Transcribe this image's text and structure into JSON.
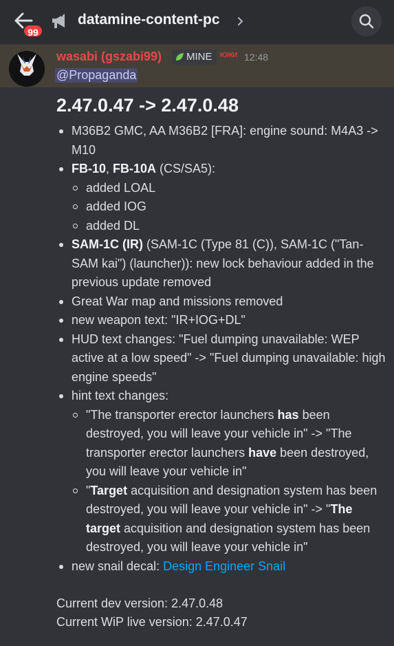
{
  "header": {
    "badge_count": "99",
    "channel_name": "datamine-content-pc"
  },
  "message": {
    "author": "wasabi (gszabi99)",
    "role_tag": "MINE",
    "server_tag": "ЮЖИ",
    "timestamp": "12:48",
    "mention": "@Propaganda",
    "heading": "2.47.0.47 -> 2.47.0.48",
    "items": {
      "m36": "M36B2 GMC, AA M36B2 [FRA]: engine sound: M4A3 -> M10",
      "fb10_a": "FB-10",
      "fb10_sep": ", ",
      "fb10_b": "FB-10A",
      "fb10_rest": " (CS/SA5):",
      "fb10_sub": [
        "added LOAL",
        "added IOG",
        "added DL"
      ],
      "sam_bold": "SAM-1C (IR)",
      "sam_rest": " (SAM-1C (Type 81 (C)), SAM-1C (\"Tan-SAM kai\") (launcher)): new lock behaviour added in the previous update removed",
      "greatwar": "Great War map and missions removed",
      "weapon_text": "new weapon text: \"IR+IOG+DL\"",
      "hud_text": "HUD text changes: \"Fuel dumping unavailable: WEP active at a low speed\" -> \"Fuel dumping unavailable: high engine speeds\"",
      "hint_label": "hint text changes:",
      "hint1_a": "\"The transporter erector launchers ",
      "hint1_b": "has",
      "hint1_c": " been destroyed, you will leave your vehicle in\" -> \"The transporter erector launchers ",
      "hint1_d": "have",
      "hint1_e": " been destroyed, you will leave your vehicle in\"",
      "hint2_a": "\"",
      "hint2_b": "Target",
      "hint2_c": " acquisition and designation system has been destroyed, you will leave your vehicle in\" -> \"",
      "hint2_d": "The target",
      "hint2_e": " acquisition and designation system has been destroyed, you will leave your vehicle in\"",
      "snail_label": "new snail decal: ",
      "snail_link": "Design Engineer Snail"
    },
    "footer": {
      "dev_version": "Current dev version: 2.47.0.48",
      "live_version": "Current WiP live version: 2.47.0.47"
    }
  },
  "colors": {
    "background": "#323339",
    "highlight": "#444037",
    "author": "#e44b4b",
    "link": "#00a8fc",
    "badge": "#f23f43"
  }
}
